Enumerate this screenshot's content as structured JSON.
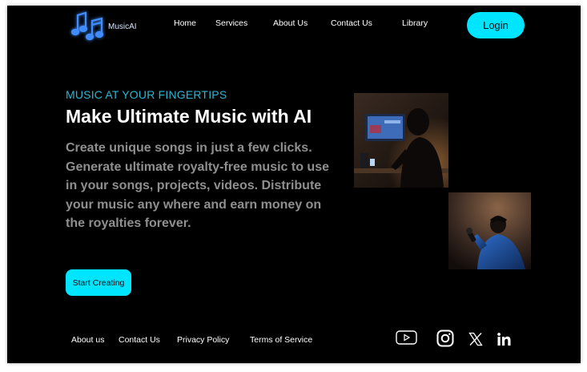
{
  "header": {
    "brand": "MusicAI",
    "nav": [
      "Home",
      "Services",
      "About Us",
      "Contact Us",
      "Library"
    ],
    "login_label": "Login"
  },
  "hero": {
    "tagline": "MUSIC AT YOUR FINGERTIPS",
    "title": "Make Ultimate Music with AI",
    "description": "Create unique songs in just a few clicks. Generate ultimate royalty-free music to use in your songs, projects, videos. Distribute your music any where and earn money on the royalties forever.",
    "cta_label": "Start Creating"
  },
  "footer": {
    "links": [
      "About us",
      "Contact Us",
      "Privacy Policy",
      "Terms of Service"
    ],
    "social_icons": [
      "youtube-icon",
      "instagram-icon",
      "x-icon",
      "linkedin-icon"
    ]
  },
  "colors": {
    "background": "#000000",
    "accent": "#00e5ff",
    "tagline": "#28b7d6",
    "body_text": "#8f8f8f"
  }
}
